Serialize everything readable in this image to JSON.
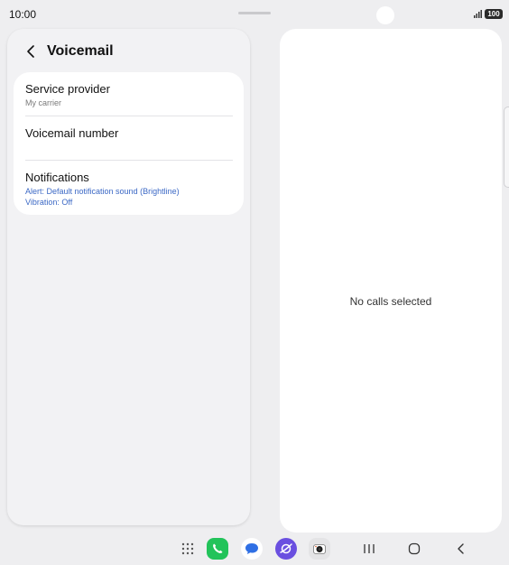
{
  "status_bar": {
    "time": "10:00",
    "battery": "100",
    "signal_icon": "signal-bars-icon"
  },
  "app_bar": {
    "back_icon": "chevron-left-icon",
    "title": "Voicemail"
  },
  "settings": [
    {
      "title": "Service provider",
      "subtitle": "My carrier"
    },
    {
      "title": "Voicemail number"
    },
    {
      "title": "Notifications",
      "lines": [
        "Alert: Default notification sound (Brightline)",
        "Vibration: Off"
      ]
    }
  ],
  "detail_panel": {
    "empty_text": "No calls selected"
  },
  "taskbar": {
    "apps": [
      "phone-icon",
      "messages-icon",
      "internet-icon",
      "camera-icon"
    ],
    "nav": [
      "recents-icon",
      "home-icon",
      "back-icon"
    ]
  },
  "colors": {
    "accent_link": "#3b68c5",
    "phone_green": "#22c35a",
    "messages_blue": "#2f6fe4",
    "internet_purple": "#6a4fe0"
  }
}
